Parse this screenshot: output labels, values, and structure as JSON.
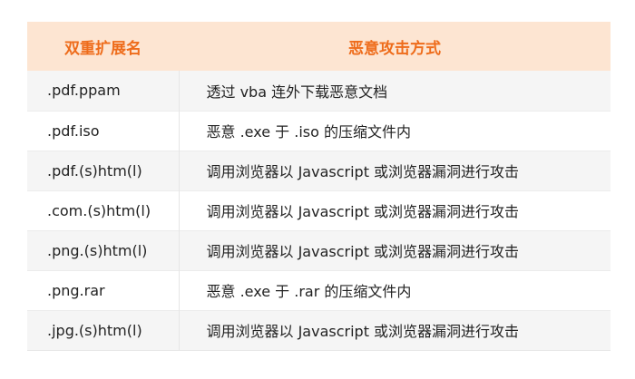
{
  "table": {
    "headers": [
      "双重扩展名",
      "恶意攻击方式"
    ],
    "rows": [
      [
        ".pdf.ppam",
        "透过 vba 连外下载恶意文档"
      ],
      [
        ".pdf.iso",
        "恶意 .exe 于 .iso 的压缩文件内"
      ],
      [
        ".pdf.(s)htm(l)",
        "调用浏览器以 Javascript 或浏览器漏洞进行攻击"
      ],
      [
        ".com.(s)htm(l)",
        "调用浏览器以 Javascript 或浏览器漏洞进行攻击"
      ],
      [
        ".png.(s)htm(l)",
        "调用浏览器以 Javascript 或浏览器漏洞进行攻击"
      ],
      [
        ".png.rar",
        "恶意 .exe 于 .rar 的压缩文件内"
      ],
      [
        ".jpg.(s)htm(l)",
        "调用浏览器以 Javascript 或浏览器漏洞进行攻击"
      ]
    ]
  },
  "colors": {
    "header_bg": "#fde5d2",
    "header_text": "#ee6c1b",
    "row_alt_bg": "#f5f5f5"
  }
}
